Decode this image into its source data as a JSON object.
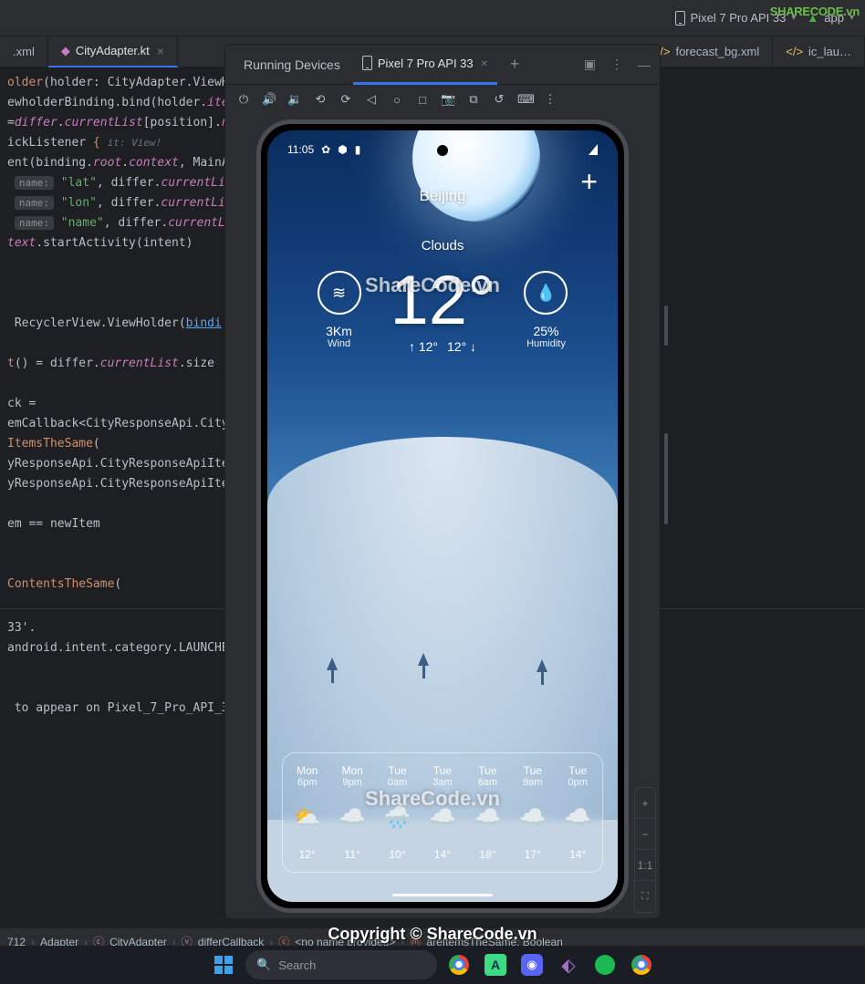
{
  "top": {
    "device": "Pixel 7 Pro API 33",
    "app": "app"
  },
  "logo": "SHARECODE.vn",
  "tabs": {
    "t0": ".xml",
    "t1": "CityAdapter.kt",
    "t2": "forecast_bg.xml",
    "t3": "ic_lau…"
  },
  "emu": {
    "title": "Running Devices",
    "device": "Pixel 7 Pro API 33"
  },
  "code": {
    "l1a": "older",
    "l1b": "(holder: CityAdapter.ViewH",
    "l2": "ewholderBinding.bind(holder.",
    "l2b": "ite",
    "l3a": "=",
    "l3b": "differ",
    "l3c": ".",
    "l3d": "currentList",
    "l3e": "[position].",
    "l3f": "n",
    "l4": "ickListener ",
    "l4b": "{",
    "l4h": "it: View!",
    "l5a": "ent(binding.",
    "l5b": "root",
    "l5c": ".",
    "l5d": "context",
    "l5e": ", MainA",
    "l6n": "name:",
    "l6s": "\"lat\"",
    "l6a": ", differ.",
    "l6b": "currentList",
    "l7n": "name:",
    "l7s": "\"lon\"",
    "l7a": ", differ.",
    "l7b": "currentList",
    "l8n": "name:",
    "l8s": "\"name\"",
    "l8a": ", differ.",
    "l8b": "currentLis",
    "l9a": "text",
    "l9b": ".startActivity(intent)",
    "l10a": " RecyclerView.ViewHolder(",
    "l10b": "bindi",
    "l11a": "t",
    "l11b": "() = differ.",
    "l11c": "currentList",
    "l11d": ".size",
    "l12": "ck =",
    "l13": "emCallback<CityResponseApi.City",
    "l14a": "ItemsTheSame",
    "l14b": "(",
    "l15": "yResponseApi.CityResponseApiIte",
    "l16": "yResponseApi.CityResponseApiIte",
    "l17": "em == newItem",
    "l18a": "ContentsTheSame",
    "l18b": "("
  },
  "log": {
    "l1": "33'.",
    "l2": "android.intent.category.LAUNCHE",
    "l3": " to appear on Pixel_7_Pro_API_3"
  },
  "weather": {
    "status_time": "11:05",
    "city": "Beijing",
    "cond": "Clouds",
    "temp": "12°",
    "hi": "12°",
    "lo": "12°",
    "wind_val": "3Km",
    "wind_lbl": "Wind",
    "hum_val": "25%",
    "hum_lbl": "Humidity",
    "forecast": [
      {
        "day": "Mon",
        "time": "6pm",
        "ico": "⛅",
        "temp": "12°"
      },
      {
        "day": "Mon",
        "time": "9pm",
        "ico": "☁️",
        "temp": "11°"
      },
      {
        "day": "Tue",
        "time": "0am",
        "ico": "🌧️",
        "temp": "10°"
      },
      {
        "day": "Tue",
        "time": "3am",
        "ico": "☁️",
        "temp": "14°"
      },
      {
        "day": "Tue",
        "time": "6am",
        "ico": "☁️",
        "temp": "18°"
      },
      {
        "day": "Tue",
        "time": "9am",
        "ico": "☁️",
        "temp": "17°"
      },
      {
        "day": "Tue",
        "time": "0pm",
        "ico": "☁️",
        "temp": "14°"
      }
    ]
  },
  "breadcrumb": {
    "b0": "712",
    "b1": "Adapter",
    "b2": "CityAdapter",
    "b3": "differCallback",
    "b4": "<no name provided>",
    "b5": "areItemsTheSame: Boolean"
  },
  "taskbar": {
    "search": "Search"
  },
  "watermark": "ShareCode.vn",
  "copyright": "Copyright © ShareCode.vn",
  "zoom11": "1:1"
}
